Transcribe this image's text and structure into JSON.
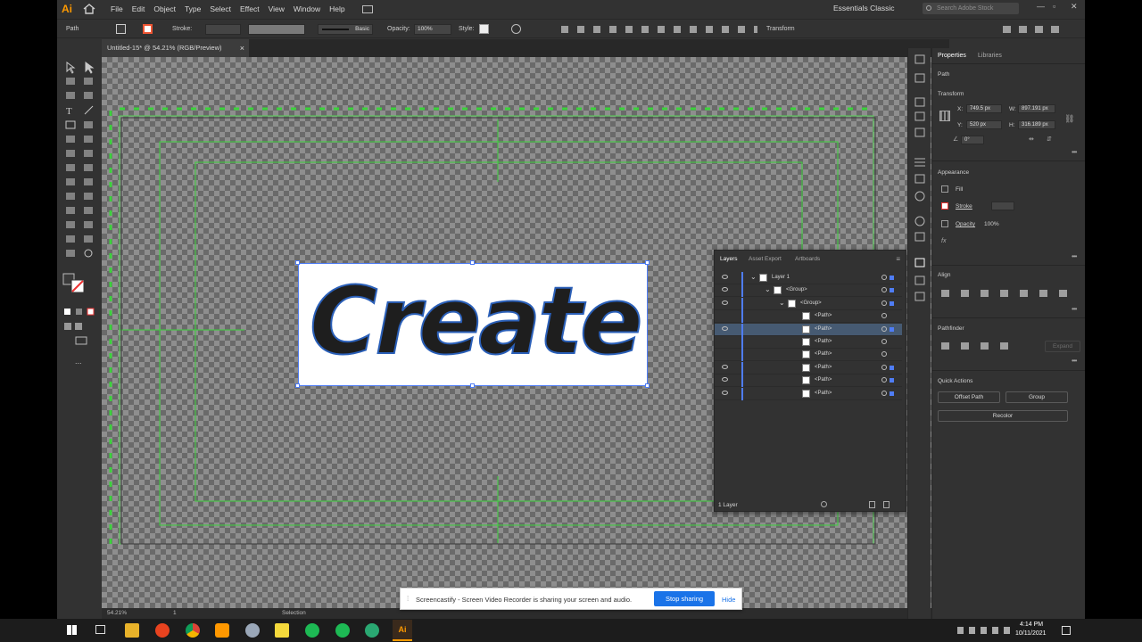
{
  "app": {
    "logo": "Ai",
    "accent": "#ff9a00",
    "selection_color": "#4f7df5",
    "guide_color": "#3cd23c"
  },
  "menu": [
    "File",
    "Edit",
    "Object",
    "Type",
    "Select",
    "Effect",
    "View",
    "Window",
    "Help"
  ],
  "workspace": "Essentials Classic",
  "search_placeholder": "Search Adobe Stock",
  "control_bar": {
    "selection_label": "Path",
    "stroke_label": "Stroke:",
    "brush_label": "Basic",
    "opacity_label": "Opacity:",
    "opacity_value": "100%",
    "style_label": "Style:",
    "transform_label": "Transform"
  },
  "document_tab": {
    "title": "Untitled-15* @ 54.21% (RGB/Preview)",
    "close": "×"
  },
  "canvas_text": "Create",
  "status_bar": {
    "zoom": "54.21%",
    "artboard": "1",
    "tool": "Selection"
  },
  "layers_panel": {
    "tabs": [
      "Layers",
      "Asset Export",
      "Artboards"
    ],
    "rows": [
      {
        "name": "Layer 1",
        "indent": 0,
        "visible": true
      },
      {
        "name": "<Group>",
        "indent": 1,
        "visible": true
      },
      {
        "name": "<Group>",
        "indent": 2,
        "visible": true
      },
      {
        "name": "<Path>",
        "indent": 3,
        "visible": false
      },
      {
        "name": "<Path>",
        "indent": 3,
        "visible": true,
        "selected": true
      },
      {
        "name": "<Path>",
        "indent": 3,
        "visible": false
      },
      {
        "name": "<Path>",
        "indent": 3,
        "visible": false
      },
      {
        "name": "<Path>",
        "indent": 3,
        "visible": true
      },
      {
        "name": "<Path>",
        "indent": 3,
        "visible": true
      },
      {
        "name": "<Path>",
        "indent": 3,
        "visible": true
      }
    ],
    "footer": "1 Layer"
  },
  "properties": {
    "tabs": [
      "Properties",
      "Libraries"
    ],
    "object_type": "Path",
    "transform": {
      "title": "Transform",
      "x": "749.5 px",
      "y": "520 px",
      "w": "897.191 px",
      "h": "316.189 px",
      "angle": "0°",
      "x_label": "X:",
      "y_label": "Y:",
      "w_label": "W:",
      "h_label": "H:"
    },
    "appearance": {
      "title": "Appearance",
      "fill": "Fill",
      "stroke": "Stroke",
      "opacity": "Opacity",
      "opacity_value": "100%"
    },
    "align_title": "Align",
    "pathfinder": {
      "title": "Pathfinder",
      "expand": "Expand"
    },
    "quick_actions": {
      "title": "Quick Actions",
      "offset_path": "Offset Path",
      "group": "Group",
      "recolor": "Recolor"
    }
  },
  "screencastify": {
    "message": "Screencastify - Screen Video Recorder is sharing your screen and audio.",
    "stop": "Stop sharing",
    "hide": "Hide"
  },
  "taskbar": {
    "time": "4:14 PM",
    "date": "10/11/2021"
  }
}
